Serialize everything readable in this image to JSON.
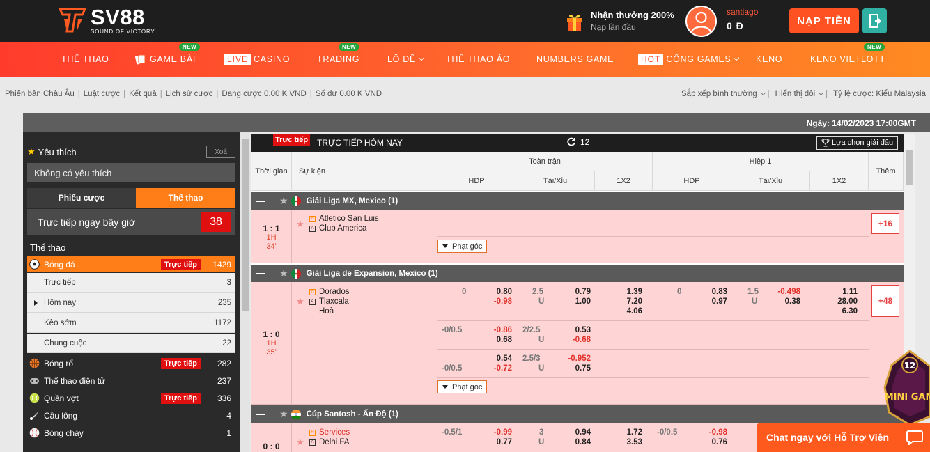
{
  "header": {
    "logo_text": "SV88",
    "logo_tagline": "SOUND OF VICTORY",
    "promo_title": "Nhận thưởng 200%",
    "promo_sub": "Nạp lần đầu",
    "username": "santiago",
    "balance": "0 Đ",
    "deposit_label": "NẠP TIỀN"
  },
  "nav": {
    "items": [
      {
        "label": "THỂ THAO"
      },
      {
        "label": "GAME BÀI",
        "badge": "NEW"
      },
      {
        "tag": "LIVE",
        "label": "CASINO"
      },
      {
        "label": "TRADING",
        "badge": "NEW"
      },
      {
        "label": "LÔ ĐỀ"
      },
      {
        "label": "THỂ THAO ẢO"
      },
      {
        "label": "NUMBERS GAME"
      },
      {
        "tag": "HOT",
        "label": "CỔNG GAMES"
      },
      {
        "label": "KENO"
      },
      {
        "label": "KENO VIETLOTT",
        "badge": "NEW"
      }
    ]
  },
  "toolbar": {
    "links": [
      "Phiên bản Châu Âu",
      "Luật cược",
      "Kết quả",
      "Lịch sử cược",
      "Đang cược 0.00 K VND",
      "Số dư 0.00 K VND"
    ],
    "sort": "Sắp xếp bình thường",
    "display": "Hiển thị đôi",
    "odds_type": "Tỷ lệ cược: Kiểu Malaysia"
  },
  "date_text": "Ngày: 14/02/2023 17:00GMT",
  "sidebar": {
    "fav_title": "Yêu thích",
    "fav_clear": "Xoá",
    "no_fav": "Không có yêu thích",
    "tab_bets": "Phiếu cược",
    "tab_sports": "Thể thao",
    "live_now": "Trực tiếp ngay bây giờ",
    "live_count": "38",
    "sports_title": "Thể thao",
    "live_tag": "Trực tiếp",
    "soccer": {
      "name": "Bóng đá",
      "count": "1429"
    },
    "soccer_sub": [
      {
        "name": "Trực tiếp",
        "count": "3"
      },
      {
        "name": "Hôm nay",
        "count": "235"
      },
      {
        "name": "Kèo sớm",
        "count": "1172"
      },
      {
        "name": "Chung cuộc",
        "count": "22"
      }
    ],
    "sports": [
      {
        "name": "Bóng rổ",
        "count": "282",
        "live": true
      },
      {
        "name": "Thể thao điện tử",
        "count": "237",
        "live": false
      },
      {
        "name": "Quần vợt",
        "count": "336",
        "live": true
      },
      {
        "name": "Cầu lông",
        "count": "4",
        "live": false
      },
      {
        "name": "Bóng chày",
        "count": "1",
        "live": false
      }
    ]
  },
  "main": {
    "live_badge": "Trực tiếp",
    "title": "TRỰC TIẾP HÔM NAY",
    "refresh_count": "12",
    "league_select": "Lựa chọn giải đấu",
    "col_time": "Thời gian",
    "col_event": "Sự kiện",
    "col_full": "Toàn trận",
    "col_half": "Hiệp 1",
    "col_more": "Thêm",
    "col_hdp": "HDP",
    "col_ou": "Tài/Xỉu",
    "col_1x2": "1X2",
    "corner_label": "Phạt góc",
    "leagues": [
      {
        "name": "Giải Liga MX, Mexico (1)",
        "score": "1 : 1",
        "period": "1H",
        "minute": "34'",
        "home": "Atletico San Luis",
        "away": "Club America",
        "more": "+16"
      },
      {
        "name": "Giải Liga de Expansion, Mexico (1)",
        "score": "1 : 0",
        "period": "1H",
        "minute": "35'",
        "home": "Dorados",
        "away": "Tlaxcala",
        "draw": "Hoà",
        "more": "+48",
        "lines": [
          {
            "hdp": "0",
            "h1": "0.80",
            "h2": "-0.98",
            "ou": "2.5",
            "u": "U",
            "o1": "0.79",
            "o2": "1.00",
            "x1": "1.39",
            "x2": "7.20",
            "x3": "4.06",
            "f_hdp": "0",
            "f_h1": "0.83",
            "f_h2": "0.97",
            "f_ou": "1.5",
            "f_u": "U",
            "f_o1": "-0.498",
            "f_o2": "0.38",
            "f_x1": "1.11",
            "f_x2": "28.00",
            "f_x3": "6.30"
          },
          {
            "hdp": "-0/0.5",
            "h1": "-0.86",
            "h2": "0.68",
            "ou": "2/2.5",
            "u": "U",
            "o1": "0.53",
            "o2": "-0.68"
          },
          {
            "hdp": "-0/0.5",
            "h1": "0.54",
            "h2": "-0.72",
            "ou": "2.5/3",
            "u": "U",
            "o1": "-0.952",
            "o2": "0.75"
          }
        ]
      },
      {
        "name": "Cúp Santosh - Ấn Độ (1)",
        "score": "0 : 0",
        "home": "Services",
        "away": "Delhi FA",
        "line": {
          "hdp": "-0.5/1",
          "h1": "-0.99",
          "h2": "0.77",
          "ou": "3",
          "u": "U",
          "o1": "0.94",
          "o2": "0.84",
          "x1": "1.72",
          "x2": "3.53",
          "f_hdp": "-0/0.5",
          "f_h1": "-0.98",
          "f_h2": "0.76"
        }
      }
    ]
  },
  "chat_label": "Chat ngay với Hỗ Trợ Viên",
  "mini_game": {
    "count": "12",
    "label": "MINI GAME"
  },
  "colors": {
    "accent": "#ff7e18",
    "live_red": "#e01010",
    "match_bg": "#ffd4d4",
    "nav_start": "#ff3c2c",
    "nav_end": "#ff8a22"
  }
}
